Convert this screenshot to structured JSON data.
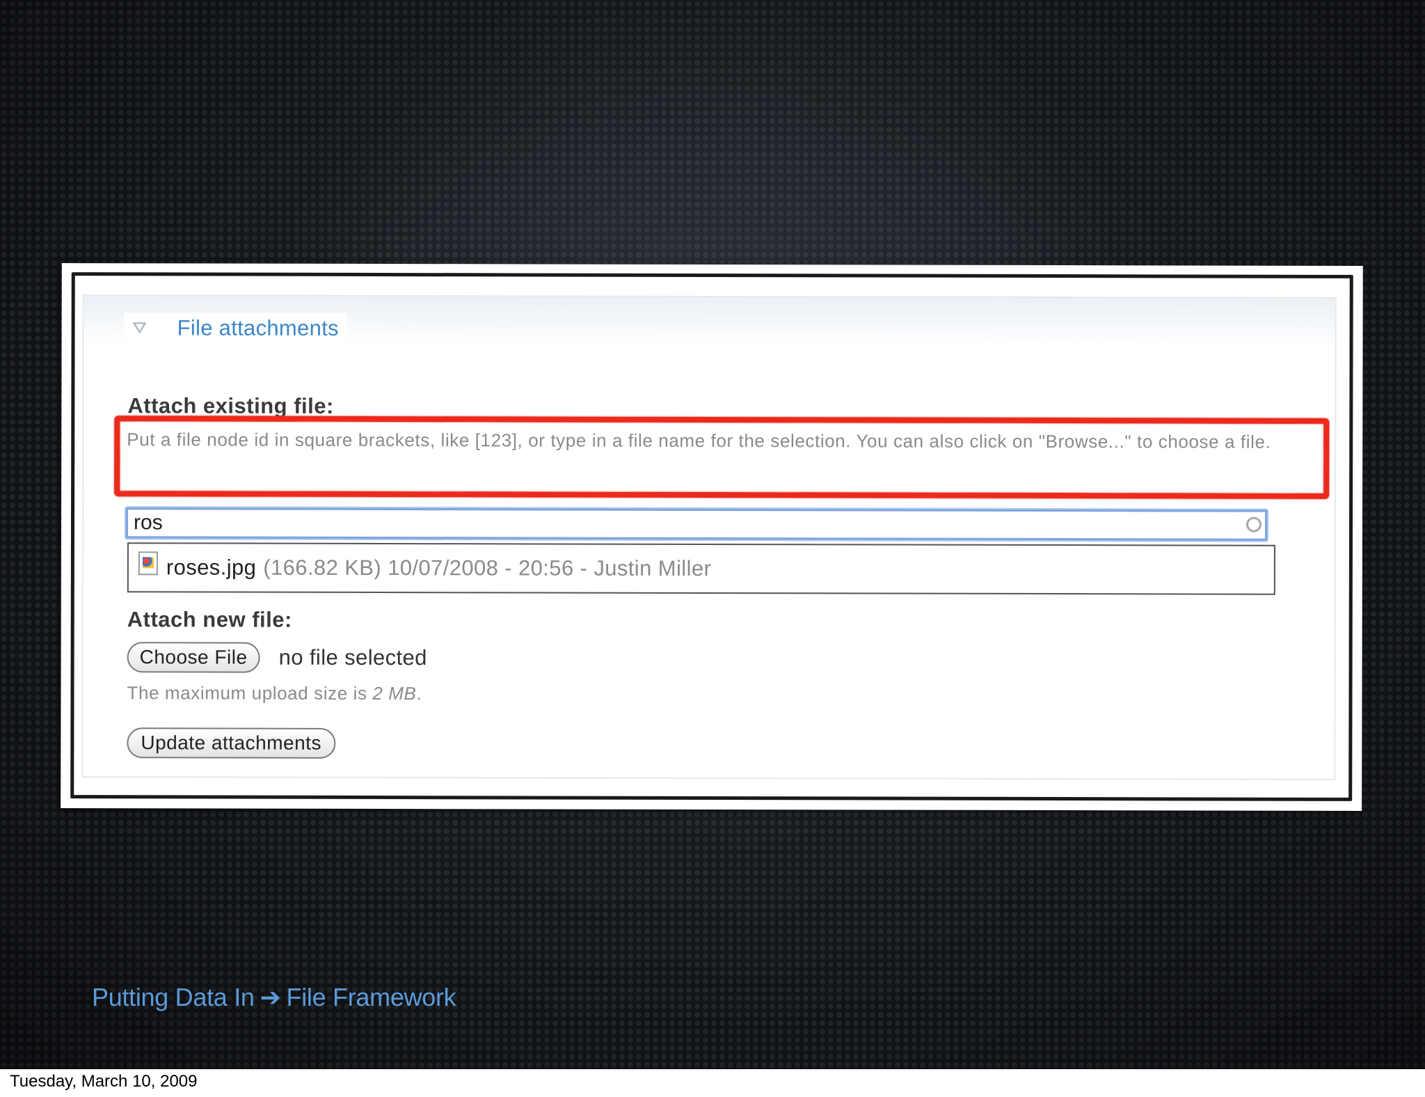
{
  "fieldset": {
    "legend": "File attachments"
  },
  "attach_existing": {
    "label": "Attach existing file:",
    "description": "Put a file node id in square brackets, like [123], or type in a file name for the selection. You can also click on \"Browse...\" to choose a file.",
    "input_value": "ros",
    "suggestions": [
      {
        "filename": "roses.jpg",
        "meta": "(166.82 KB) 10/07/2008 - 20:56 - Justin Miller"
      }
    ]
  },
  "attach_new": {
    "label": "Attach new file:",
    "choose_button": "Choose File",
    "no_file_text": "no file selected",
    "help_prefix": "The maximum upload size is ",
    "help_size": "2 MB",
    "help_suffix": "."
  },
  "update_button": "Update attachments",
  "slide_footer": {
    "left": "Putting Data In",
    "arrow": "➔",
    "right": "File Framework"
  },
  "print_footer": "Tuesday, March 10, 2009",
  "colors": {
    "highlight": "#ec2a1c",
    "legend_link": "#3a86c8",
    "footer_text": "#5b9bd9"
  },
  "icons": {
    "legend_toggle": "triangle-down-icon",
    "throbber": "throbber-icon",
    "file_type": "image-file-icon"
  }
}
